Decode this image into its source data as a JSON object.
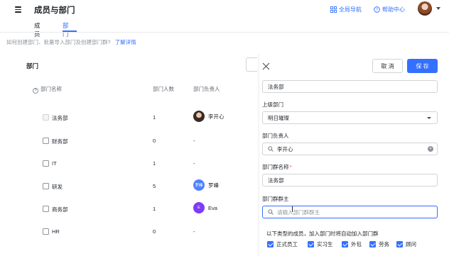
{
  "header": {
    "title": "成员与部门",
    "global_nav_label": "全局导航",
    "help_center_label": "帮助中心"
  },
  "tabs": [
    {
      "label": "成员",
      "active": false
    },
    {
      "label": "部门",
      "active": true
    }
  ],
  "help_row": {
    "text": "如何创建部门、批量导入部门及创建部门群?",
    "link": "了解详情"
  },
  "left": {
    "title": "部门",
    "columns": [
      "部门名称",
      "部门人数",
      "部门负责人"
    ],
    "rows": [
      {
        "name": "法务部",
        "count": "1",
        "lead": "李开心",
        "avatar_text": "",
        "avatar": "photo",
        "checkbox_disabled": true
      },
      {
        "name": "财务部",
        "count": "0",
        "lead": "-",
        "avatar_text": "",
        "avatar": "none",
        "checkbox_disabled": false
      },
      {
        "name": "IT",
        "count": "1",
        "lead": "-",
        "avatar_text": "",
        "avatar": "none",
        "checkbox_disabled": false
      },
      {
        "name": "研发",
        "count": "5",
        "lead": "罗峰",
        "avatar_text": "罗峰",
        "avatar": "blue",
        "checkbox_disabled": false
      },
      {
        "name": "商务部",
        "count": "1",
        "lead": "Eva",
        "avatar_text": "E",
        "avatar": "purple",
        "checkbox_disabled": false
      },
      {
        "name": "HR",
        "count": "0",
        "lead": "-",
        "avatar_text": "",
        "avatar": "none",
        "checkbox_disabled": false
      }
    ]
  },
  "panel": {
    "cancel_label": "取 消",
    "save_label": "保 存",
    "dept_name_value": "法务部",
    "parent_label": "上级部门",
    "parent_value": "明日璀璨",
    "lead_label": "部门负责人",
    "lead_value": "李开心",
    "group_name_label": "部门群名称",
    "group_name_required": "*",
    "group_name_value": "法务部",
    "group_owner_label": "部门群群主",
    "group_owner_placeholder": "请输入部门群群主",
    "note": "以下类型的成员，加入部门时将自动加入部门群",
    "member_types": [
      {
        "label": "正式员工",
        "checked": true
      },
      {
        "label": "实习生",
        "checked": true
      },
      {
        "label": "外包",
        "checked": true
      },
      {
        "label": "劳务",
        "checked": true
      },
      {
        "label": "顾问",
        "checked": true
      }
    ]
  },
  "colors": {
    "accent": "#3370ff",
    "text": "#1f2329",
    "muted": "#8f959e",
    "avatar_blue": "#4e83fd",
    "avatar_purple": "#7f3bf5",
    "required": "#f54a45"
  }
}
